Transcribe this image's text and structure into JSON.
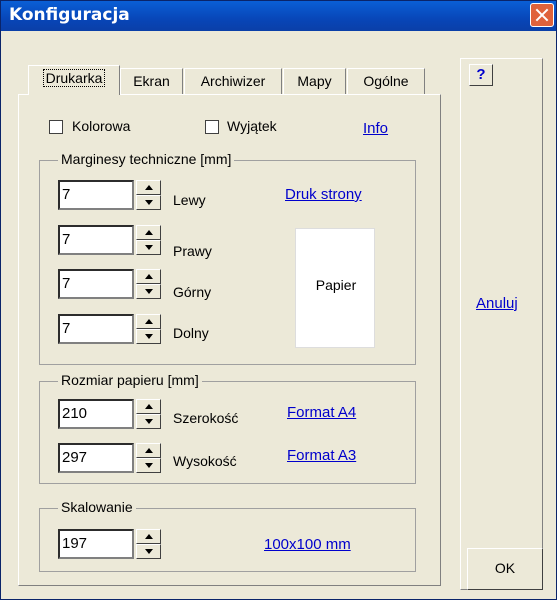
{
  "window": {
    "title": "Konfiguracja"
  },
  "tabs": [
    "Drukarka",
    "Ekran",
    "Archiwizer",
    "Mapy",
    "Ogólne"
  ],
  "options": {
    "kolorowa": "Kolorowa",
    "wyjatek": "Wyjątek",
    "info": "Info"
  },
  "margins": {
    "title": "Marginesy techniczne [mm]",
    "fields": [
      {
        "value": "7",
        "label": "Lewy"
      },
      {
        "value": "7",
        "label": "Prawy"
      },
      {
        "value": "7",
        "label": "Górny"
      },
      {
        "value": "7",
        "label": "Dolny"
      }
    ],
    "print_link": "Druk strony",
    "paper_label": "Papier"
  },
  "paper_size": {
    "title": "Rozmiar papieru [mm]",
    "fields": [
      {
        "value": "210",
        "label": "Szerokość",
        "link": "Format A4"
      },
      {
        "value": "297",
        "label": "Wysokość",
        "link": "Format A3"
      }
    ]
  },
  "scaling": {
    "title": "Skalowanie",
    "value": "197",
    "link": "100x100 mm"
  },
  "side": {
    "help": "?",
    "cancel": "Anuluj",
    "ok": "OK"
  }
}
